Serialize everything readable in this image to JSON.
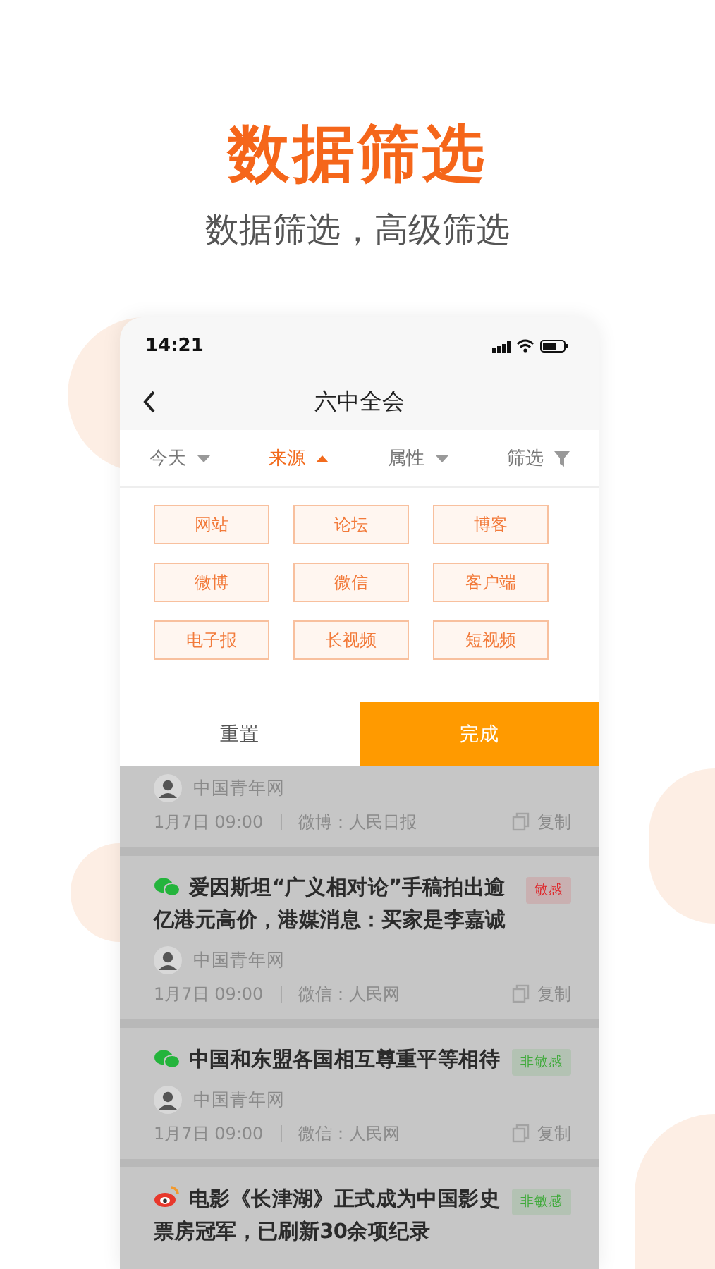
{
  "header": {
    "title": "数据筛选",
    "subtitle": "数据筛选，高级筛选"
  },
  "status_bar": {
    "time": "14:21"
  },
  "nav": {
    "title": "六中全会"
  },
  "filter_tabs": [
    {
      "label": "今天",
      "selected": false,
      "kind": "dropdown"
    },
    {
      "label": "来源",
      "selected": true,
      "kind": "dropdown"
    },
    {
      "label": "属性",
      "selected": false,
      "kind": "dropdown"
    },
    {
      "label": "筛选",
      "selected": false,
      "kind": "filter"
    }
  ],
  "source_options": [
    "网站",
    "论坛",
    "博客",
    "微博",
    "微信",
    "客户端",
    "电子报",
    "长视频",
    "短视频"
  ],
  "actions": {
    "reset": "重置",
    "done": "完成"
  },
  "articles": [
    {
      "author": "中国青年网",
      "time": "1月7日 09:00",
      "channel": "微博：人民日报",
      "copy": "复制"
    },
    {
      "kind": "wechat",
      "title": "爱因斯坦“广义相对论”手稿拍出逾亿港元高价，港媒消息：买家是李嘉诚",
      "tag": {
        "label": "敏感",
        "color": "#e0262a"
      },
      "author": "中国青年网",
      "time": "1月7日 09:00",
      "channel": "微信：人民网",
      "copy": "复制"
    },
    {
      "kind": "wechat",
      "title": "中国和东盟各国相互尊重平等相待",
      "tag": {
        "label": "非敏感",
        "color": "#3faa3a"
      },
      "author": "中国青年网",
      "time": "1月7日 09:00",
      "channel": "微信：人民网",
      "copy": "复制"
    },
    {
      "kind": "weibo",
      "title": "电影《长津湖》正式成为中国影史票房冠军，已刷新30余项纪录",
      "tag": {
        "label": "非敏感",
        "color": "#3faa3a"
      }
    }
  ]
}
